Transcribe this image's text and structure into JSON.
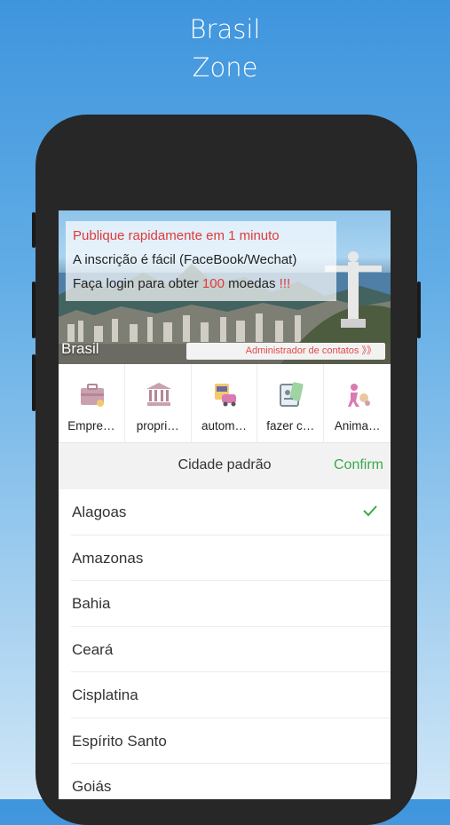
{
  "promo": {
    "title_line1": "Brasil",
    "title_line2": "Zone"
  },
  "banner": {
    "line1": "Publique rapidamente em 1 minuto",
    "line2": "A inscrição é fácil (FaceBook/Wechat)",
    "line3_prefix": "Faça login para obter ",
    "line3_number": "100",
    "line3_suffix": " moedas ",
    "line3_excl": "!!!",
    "country": "Brasil",
    "admin_link": "Administrador de contatos 》》"
  },
  "categories": [
    {
      "label": "Empre…",
      "icon": "briefcase-icon"
    },
    {
      "label": "propri…",
      "icon": "building-icon"
    },
    {
      "label": "autom…",
      "icon": "car-icon"
    },
    {
      "label": "fazer c…",
      "icon": "id-card-icon"
    },
    {
      "label": "Anima…",
      "icon": "pet-icon"
    }
  ],
  "picker": {
    "title": "Cidade padrão",
    "confirm_label": "Confirm",
    "items": [
      "Alagoas",
      "Amazonas",
      "Bahia",
      "Ceará",
      "Cisplatina",
      "Espírito Santo",
      "Goiás"
    ],
    "selected": "Alagoas"
  },
  "colors": {
    "accent_green": "#3aa94a",
    "red": "#e03a3a",
    "phone": "#272727"
  }
}
